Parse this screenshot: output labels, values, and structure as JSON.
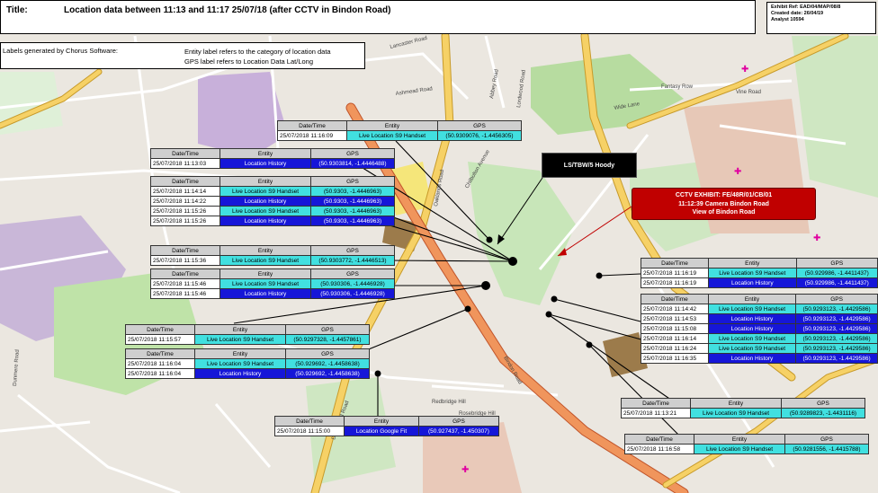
{
  "header": {
    "title_label": "Title:",
    "title_text": "Location data between 11:13 and 11:17  25/07/18 (after CCTV in Bindon Road)"
  },
  "exhibit": {
    "ref": "Exhibit Ref: EAD/04/MAP/08/8",
    "created": "Created date: 26/04/19",
    "analyst": "Analyst 10594"
  },
  "labels_note": {
    "left": "Labels generated by Chorus Software:",
    "line1": "Entity label refers to the category of location data",
    "line2": "GPS label refers to Location Data Lat/Long"
  },
  "columns": {
    "dt": "Date/Time",
    "entity": "Entity",
    "gps": "GPS"
  },
  "callouts": {
    "lstbw": "LS/TBW/5 Hoody",
    "cctv_l1": "CCTV EXHIBIT: FE/48R/01/CB/01",
    "cctv_l2": "11:12:39 Camera Bindon Road",
    "cctv_l3": "View of Bindon Road"
  },
  "tables": [
    {
      "rows": [
        {
          "dt": "25/07/2018 11:16:09",
          "entity": "Live Location S9 Handset",
          "gps": "(50.9309076, -1.4456305)",
          "kind": "live"
        }
      ]
    },
    {
      "rows": [
        {
          "dt": "25/07/2018 11:13:03",
          "entity": "Location History",
          "gps": "(50.9303814, -1.4446488)",
          "kind": "hist"
        }
      ]
    },
    {
      "rows": [
        {
          "dt": "25/07/2018 11:14:14",
          "entity": "Live Location S9 Handset",
          "gps": "(50.9303, -1.4446963)",
          "kind": "live"
        },
        {
          "dt": "25/07/2018 11:14:22",
          "entity": "Location History",
          "gps": "(50.9303, -1.4446963)",
          "kind": "hist"
        },
        {
          "dt": "25/07/2018 11:15:26",
          "entity": "Live Location S9 Handset",
          "gps": "(50.9303, -1.4446963)",
          "kind": "live"
        },
        {
          "dt": "25/07/2018 11:15:26",
          "entity": "Location History",
          "gps": "(50.9303, -1.4446963)",
          "kind": "hist"
        }
      ]
    },
    {
      "rows": [
        {
          "dt": "25/07/2018 11:15:36",
          "entity": "Live Location S9 Handset",
          "gps": "(50.9303772, -1.4446513)",
          "kind": "live"
        }
      ]
    },
    {
      "rows": [
        {
          "dt": "25/07/2018 11:15:46",
          "entity": "Live Location S9 Handset",
          "gps": "(50.930306, -1.4446928)",
          "kind": "live"
        },
        {
          "dt": "25/07/2018 11:15:46",
          "entity": "Location History",
          "gps": "(50.930306, -1.4446928)",
          "kind": "hist"
        }
      ]
    },
    {
      "rows": [
        {
          "dt": "25/07/2018 11:15:57",
          "entity": "Live Location S9 Handset",
          "gps": "(50.9297328, -1.4457861)",
          "kind": "live"
        }
      ]
    },
    {
      "rows": [
        {
          "dt": "25/07/2018 11:16:04",
          "entity": "Live Location S9 Handset",
          "gps": "(50.929692, -1.4458638)",
          "kind": "live"
        },
        {
          "dt": "25/07/2018 11:16:04",
          "entity": "Location History",
          "gps": "(50.929692, -1.4458638)",
          "kind": "hist"
        }
      ]
    },
    {
      "rows": [
        {
          "dt": "25/07/2018 11:15:00",
          "entity": "Location Google Fit",
          "gps": "(50.927437, -1.450307)",
          "kind": "gfit"
        }
      ]
    },
    {
      "rows": [
        {
          "dt": "25/07/2018 11:16:19",
          "entity": "Live Location S9 Handset",
          "gps": "(50.929986, -1.4411437)",
          "kind": "live"
        },
        {
          "dt": "25/07/2018 11:16:19",
          "entity": "Location History",
          "gps": "(50.929986, -1.4411437)",
          "kind": "hist"
        }
      ]
    },
    {
      "rows": [
        {
          "dt": "25/07/2018 11:14:42",
          "entity": "Live Location S9 Handset",
          "gps": "(50.9293123, -1.4429586)",
          "kind": "live"
        },
        {
          "dt": "25/07/2018 11:14:53",
          "entity": "Location History",
          "gps": "(50.9293123, -1.4429586)",
          "kind": "hist"
        },
        {
          "dt": "25/07/2018 11:15:08",
          "entity": "Location History",
          "gps": "(50.9293123, -1.4429586)",
          "kind": "hist"
        },
        {
          "dt": "25/07/2018 11:16:14",
          "entity": "Live Location S9 Handset",
          "gps": "(50.9293123, -1.4429586)",
          "kind": "live"
        },
        {
          "dt": "25/07/2018 11:16:24",
          "entity": "Live Location S9 Handset",
          "gps": "(50.9293123, -1.4429586)",
          "kind": "live"
        },
        {
          "dt": "25/07/2018 11:16:35",
          "entity": "Location History",
          "gps": "(50.9293123, -1.4429586)",
          "kind": "hist"
        }
      ]
    },
    {
      "rows": [
        {
          "dt": "25/07/2018 11:13:21",
          "entity": "Live Location S9 Handset",
          "gps": "(50.9289823, -1.4431116)",
          "kind": "live"
        }
      ]
    },
    {
      "rows": [
        {
          "dt": "25/07/2018 11:16:58",
          "entity": "Live Location S9 Handset",
          "gps": "(50.9281556, -1.4415788)",
          "kind": "live"
        }
      ]
    }
  ],
  "street_labels": [
    "Lancaster Road",
    "Ashmead Road",
    "Abbey Road",
    "Lordwood Road",
    "Wide Lane",
    "Oaklands Road",
    "Chilbolton Avenue",
    "Redbridge Hill",
    "Rosebridge Hill",
    "Bindon Road",
    "Dunmere Road",
    "Fantasy Row",
    "Vine Road",
    "Drummond Road"
  ],
  "colors": {
    "live": "#41e0e0",
    "history": "#1616d8",
    "cctv": "#c00000",
    "road_major": "#f6c74b",
    "road_primary": "#f0955c"
  }
}
